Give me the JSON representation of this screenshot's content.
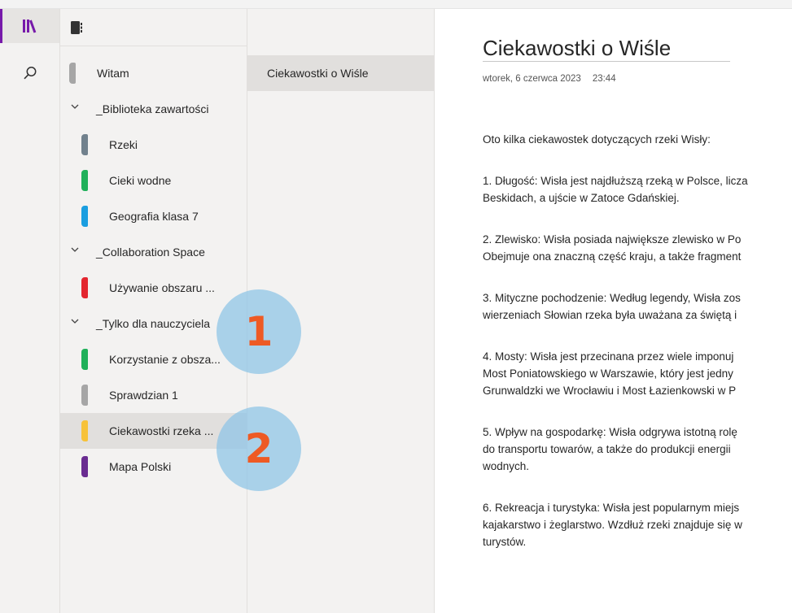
{
  "colors": {
    "accent": "#7719aa",
    "callout_fill": "#8cc3e6",
    "callout_number": "#ee5a24"
  },
  "rail": {
    "items": [
      {
        "icon": "notebooks-icon",
        "active": true
      },
      {
        "icon": "search-icon",
        "active": false
      }
    ]
  },
  "notebook_header": {
    "icon": "notebook-icon"
  },
  "sections": [
    {
      "kind": "top",
      "label": "Witam",
      "color": "#a6a6a6"
    },
    {
      "kind": "group",
      "label": "_Biblioteka zawartości"
    },
    {
      "kind": "section",
      "label": "Rzeki",
      "color": "#71818d"
    },
    {
      "kind": "section",
      "label": "Cieki wodne",
      "color": "#20b05a"
    },
    {
      "kind": "section",
      "label": "Geografia klasa 7",
      "color": "#1a9ee0"
    },
    {
      "kind": "group",
      "label": "_Collaboration Space"
    },
    {
      "kind": "section",
      "label": "Używanie obszaru ...",
      "color": "#e3262f"
    },
    {
      "kind": "group",
      "label": "_Tylko dla nauczyciela"
    },
    {
      "kind": "section",
      "label": "Korzystanie z obsza...",
      "color": "#20b05a"
    },
    {
      "kind": "section",
      "label": "Sprawdzian 1",
      "color": "#a6a6a6"
    },
    {
      "kind": "section",
      "label": "Ciekawostki rzeka ...",
      "color": "#f7c23a",
      "selected": true
    },
    {
      "kind": "section",
      "label": "Mapa Polski",
      "color": "#6a2c91"
    }
  ],
  "pages": [
    {
      "label": "Ciekawostki o Wiśle",
      "selected": true
    }
  ],
  "page": {
    "title": "Ciekawostki o Wiśle",
    "date": "wtorek, 6 czerwca 2023",
    "time": "23:44",
    "paragraphs": [
      [
        "Oto kilka ciekawostek dotyczących rzeki Wisły:"
      ],
      [
        "1. Długość: Wisła jest najdłuższą rzeką w Polsce, licza",
        "Beskidach, a ujście w Zatoce Gdańskiej."
      ],
      [
        "2. Zlewisko: Wisła posiada największe zlewisko w Po",
        "Obejmuje ona znaczną część kraju, a także fragment"
      ],
      [
        "3. Mityczne pochodzenie: Według legendy, Wisła zos",
        "wierzeniach Słowian rzeka była uważana za świętą i"
      ],
      [
        "4. Mosty: Wisła jest przecinana przez wiele imponuj",
        "Most Poniatowskiego w Warszawie, który jest jedny",
        "Grunwaldzki we Wrocławiu i Most Łazienkowski w P"
      ],
      [
        "5. Wpływ na gospodarkę: Wisła odgrywa istotną rolę",
        "do transportu towarów, a także do produkcji energii",
        "wodnych."
      ],
      [
        "6. Rekreacja i turystyka: Wisła jest popularnym miejs",
        "kajakarstwo i żeglarstwo. Wzdłuż rzeki znajduje się w",
        "turystów."
      ]
    ]
  },
  "callouts": [
    {
      "number": "1"
    },
    {
      "number": "2"
    }
  ]
}
